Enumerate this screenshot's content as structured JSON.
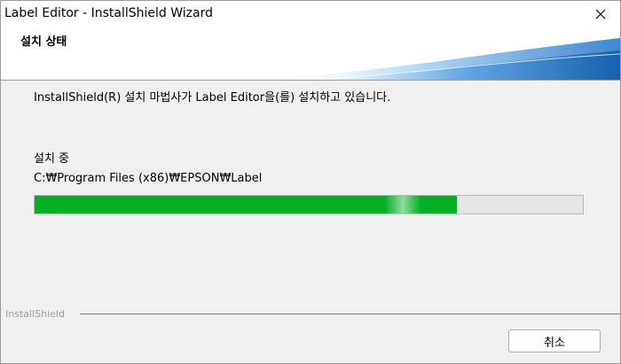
{
  "window": {
    "title": "Label Editor - InstallShield Wizard",
    "close_icon": "close-icon"
  },
  "header": {
    "title": "설치 상태"
  },
  "main": {
    "description": "InstallShield(R) 설치 마법사가 Label Editor을(를) 설치하고 있습니다.",
    "status_label": "설치 중",
    "path": "C:₩Program Files (x86)₩EPSON₩Label",
    "progress_fraction": 0.77
  },
  "footer": {
    "brand": "InstallShield",
    "cancel_label": "취소"
  },
  "colors": {
    "progress_fill": "#06b025",
    "swoosh_primary": "#1f6fc0",
    "swoosh_light": "#8fc3ef"
  }
}
